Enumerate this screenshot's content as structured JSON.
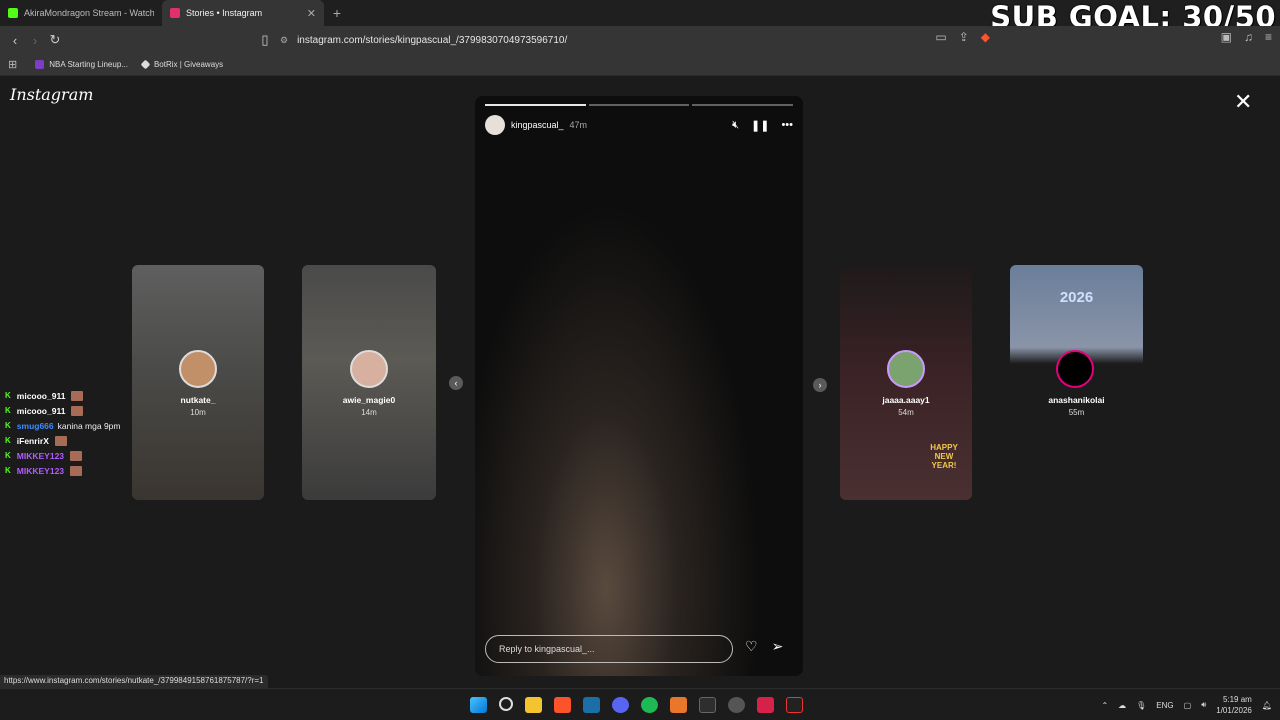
{
  "browser": {
    "tabs": [
      {
        "title": "AkiraMondragon Stream - Watch Live",
        "icon": "kick-icon",
        "color": "#53fc18",
        "active": false
      },
      {
        "title": "Stories • Instagram",
        "icon": "instagram-icon",
        "color": "#e1306c",
        "active": true
      }
    ],
    "url": "instagram.com/stories/kingpascual_/3799830704973596710/",
    "bookmarks": [
      {
        "label": "NBA Starting Lineup..."
      },
      {
        "label": "BotRix | Giveaways"
      }
    ]
  },
  "overlay": {
    "sub_goal": "SUB GOAL: 30/50"
  },
  "instagram": {
    "logo": "Instagram",
    "story": {
      "username": "kingpascual_",
      "time": "47m",
      "reply_placeholder": "Reply to kingpascual_..."
    },
    "previews": [
      {
        "name": "nutkate_",
        "time": "10m"
      },
      {
        "name": "awie_magie0",
        "time": "14m"
      },
      {
        "name": "jaaaa.aaay1",
        "time": "54m"
      },
      {
        "name": "anashanikolai",
        "time": "55m"
      }
    ],
    "preview_text": {
      "happy_new_year": "HAPPY NEW YEAR!",
      "year_banner": "2026"
    }
  },
  "chat": [
    {
      "user": "micooo_911",
      "color": "#ffffff",
      "message": ""
    },
    {
      "user": "micooo_911",
      "color": "#ffffff",
      "message": ""
    },
    {
      "user": "smug666",
      "color": "#3d8bff",
      "message": "kanina mga 9pm"
    },
    {
      "user": "iFenrirX",
      "color": "#ffffff",
      "message": ""
    },
    {
      "user": "MIKKEY123",
      "color": "#b25cff",
      "message": ""
    },
    {
      "user": "MIKKEY123",
      "color": "#b25cff",
      "message": ""
    }
  ],
  "status_url": "https://www.instagram.com/stories/nutkate_/3799849158761875787/?r=1",
  "taskbar": {
    "lang": "ENG",
    "time": "5:19 am",
    "date": "1/01/2026"
  }
}
